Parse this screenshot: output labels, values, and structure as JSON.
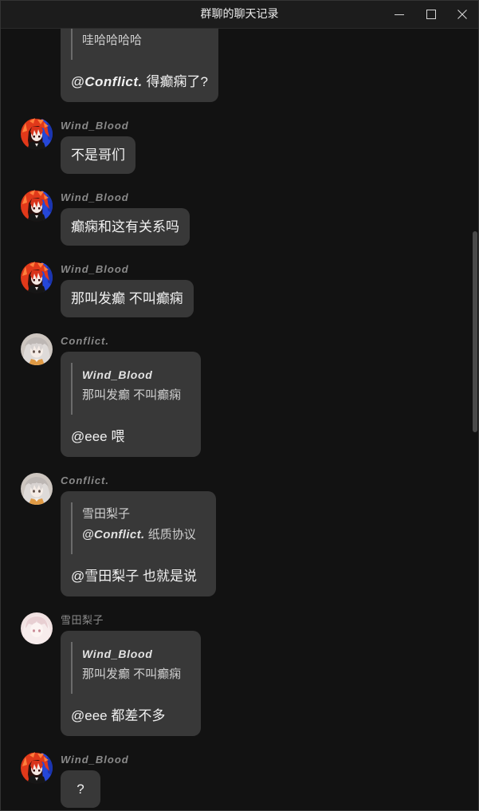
{
  "window": {
    "title": "群聊的聊天记录",
    "controls": [
      "minimize-icon",
      "maximize-icon",
      "close-icon"
    ]
  },
  "colors": {
    "background": "#121212",
    "title_bar": "#1c1c1c",
    "bubble": "#383838",
    "sender_name": "#8a8a8a",
    "message_text": "#f1f1f1",
    "quote_text": "#cfcfcf",
    "quote_bar": "#6b6b6b",
    "scrollbar": "#4a4a4a"
  },
  "messages": [
    {
      "quote": {
        "segments": [
          "哇哈哈哈哈"
        ]
      },
      "segments": [
        "@",
        "Conflict.",
        " 得癫痫了?"
      ]
    },
    {
      "sender": "Wind_Blood",
      "avatar": "red-hair-anime-avatar",
      "segments": [
        "不是哥们"
      ]
    },
    {
      "sender": "Wind_Blood",
      "avatar": "red-hair-anime-avatar",
      "segments": [
        "癫痫和这有关系吗"
      ]
    },
    {
      "sender": "Wind_Blood",
      "avatar": "red-hair-anime-avatar",
      "segments": [
        "那叫发癫 不叫癫痫"
      ]
    },
    {
      "sender": "Conflict.",
      "avatar": "silver-hair-anime-avatar",
      "quote": {
        "sender": "Wind_Blood",
        "segments": [
          "那叫发癫 不叫癫痫"
        ]
      },
      "segments": [
        "@eee 喂"
      ]
    },
    {
      "sender": "Conflict.",
      "avatar": "silver-hair-anime-avatar",
      "quote": {
        "sender": "雪田梨子",
        "segments": [
          "@Conflict.",
          " 纸质协议"
        ]
      },
      "segments": [
        "@雪田梨子 也就是说"
      ]
    },
    {
      "sender": "雪田梨子",
      "avatar": "pink-anime-avatar",
      "quote": {
        "sender": "Wind_Blood",
        "segments": [
          "那叫发癫 不叫癫痫"
        ]
      },
      "segments": [
        "@eee 都差不多"
      ]
    },
    {
      "sender": "Wind_Blood",
      "avatar": "red-hair-anime-avatar",
      "segments": [
        "?"
      ]
    }
  ]
}
